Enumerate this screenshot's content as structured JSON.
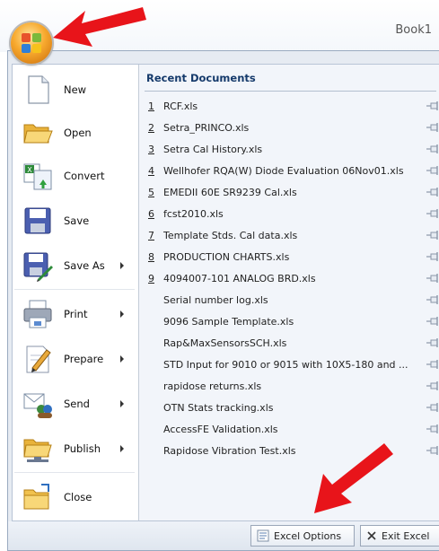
{
  "window": {
    "title": "Book1"
  },
  "left_menu": [
    {
      "label": "New",
      "submenu": false,
      "icon": "new-document-icon"
    },
    {
      "label": "Open",
      "submenu": false,
      "icon": "open-folder-icon"
    },
    {
      "label": "Convert",
      "submenu": false,
      "icon": "convert-icon"
    },
    {
      "label": "Save",
      "submenu": false,
      "icon": "save-icon"
    },
    {
      "label": "Save As",
      "submenu": true,
      "icon": "save-as-icon"
    },
    {
      "label": "Print",
      "submenu": true,
      "icon": "print-icon"
    },
    {
      "label": "Prepare",
      "submenu": true,
      "icon": "prepare-icon"
    },
    {
      "label": "Send",
      "submenu": true,
      "icon": "send-icon"
    },
    {
      "label": "Publish",
      "submenu": true,
      "icon": "publish-icon"
    },
    {
      "label": "Close",
      "submenu": false,
      "icon": "close-folder-icon"
    }
  ],
  "recent": {
    "header": "Recent Documents",
    "items": [
      {
        "num": "1",
        "name": "RCF.xls"
      },
      {
        "num": "2",
        "name": "Setra_PRINCO.xls"
      },
      {
        "num": "3",
        "name": "Setra Cal History.xls"
      },
      {
        "num": "4",
        "name": "Wellhofer RQA(W) Diode Evaluation 06Nov01.xls"
      },
      {
        "num": "5",
        "name": "EMEDII 60E SR9239 Cal.xls"
      },
      {
        "num": "6",
        "name": "fcst2010.xls"
      },
      {
        "num": "7",
        "name": "Template Stds. Cal data.xls"
      },
      {
        "num": "8",
        "name": "PRODUCTION CHARTS.xls"
      },
      {
        "num": "9",
        "name": "4094007-101 ANALOG BRD.xls"
      },
      {
        "num": "",
        "name": "Serial number log.xls"
      },
      {
        "num": "",
        "name": "9096 Sample Template.xls"
      },
      {
        "num": "",
        "name": "Rap&MaxSensorsSCH.xls"
      },
      {
        "num": "",
        "name": "STD Input for 9010 or 9015 with 10X5-180 and ..."
      },
      {
        "num": "",
        "name": "rapidose returns.xls"
      },
      {
        "num": "",
        "name": "OTN Stats tracking.xls"
      },
      {
        "num": "",
        "name": "AccessFE Validation.xls"
      },
      {
        "num": "",
        "name": "Rapidose Vibration Test.xls"
      }
    ]
  },
  "footer": {
    "options_label": "Excel Options",
    "exit_label": "Exit Excel"
  },
  "colors": {
    "accent_arrow": "#e8141a",
    "header_text": "#153a6b",
    "menu_frame": "#e6ebf2"
  }
}
